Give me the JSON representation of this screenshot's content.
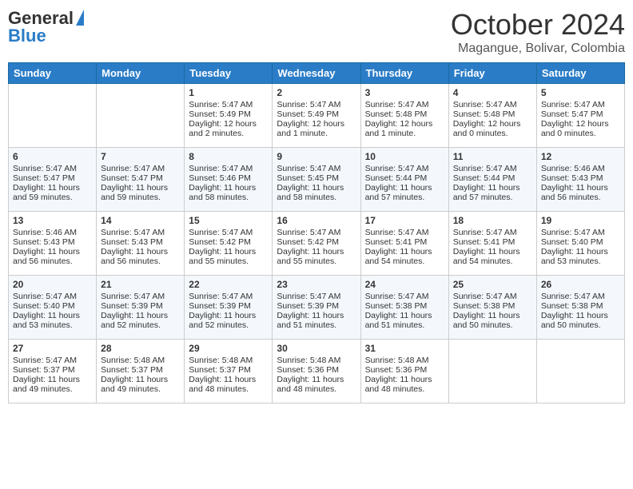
{
  "header": {
    "logo_general": "General",
    "logo_blue": "Blue",
    "month": "October 2024",
    "location": "Magangue, Bolivar, Colombia"
  },
  "days_of_week": [
    "Sunday",
    "Monday",
    "Tuesday",
    "Wednesday",
    "Thursday",
    "Friday",
    "Saturday"
  ],
  "weeks": [
    [
      {
        "day": "",
        "sunrise": "",
        "sunset": "",
        "daylight": ""
      },
      {
        "day": "",
        "sunrise": "",
        "sunset": "",
        "daylight": ""
      },
      {
        "day": "1",
        "sunrise": "Sunrise: 5:47 AM",
        "sunset": "Sunset: 5:49 PM",
        "daylight": "Daylight: 12 hours and 2 minutes."
      },
      {
        "day": "2",
        "sunrise": "Sunrise: 5:47 AM",
        "sunset": "Sunset: 5:49 PM",
        "daylight": "Daylight: 12 hours and 1 minute."
      },
      {
        "day": "3",
        "sunrise": "Sunrise: 5:47 AM",
        "sunset": "Sunset: 5:48 PM",
        "daylight": "Daylight: 12 hours and 1 minute."
      },
      {
        "day": "4",
        "sunrise": "Sunrise: 5:47 AM",
        "sunset": "Sunset: 5:48 PM",
        "daylight": "Daylight: 12 hours and 0 minutes."
      },
      {
        "day": "5",
        "sunrise": "Sunrise: 5:47 AM",
        "sunset": "Sunset: 5:47 PM",
        "daylight": "Daylight: 12 hours and 0 minutes."
      }
    ],
    [
      {
        "day": "6",
        "sunrise": "Sunrise: 5:47 AM",
        "sunset": "Sunset: 5:47 PM",
        "daylight": "Daylight: 11 hours and 59 minutes."
      },
      {
        "day": "7",
        "sunrise": "Sunrise: 5:47 AM",
        "sunset": "Sunset: 5:47 PM",
        "daylight": "Daylight: 11 hours and 59 minutes."
      },
      {
        "day": "8",
        "sunrise": "Sunrise: 5:47 AM",
        "sunset": "Sunset: 5:46 PM",
        "daylight": "Daylight: 11 hours and 58 minutes."
      },
      {
        "day": "9",
        "sunrise": "Sunrise: 5:47 AM",
        "sunset": "Sunset: 5:45 PM",
        "daylight": "Daylight: 11 hours and 58 minutes."
      },
      {
        "day": "10",
        "sunrise": "Sunrise: 5:47 AM",
        "sunset": "Sunset: 5:44 PM",
        "daylight": "Daylight: 11 hours and 57 minutes."
      },
      {
        "day": "11",
        "sunrise": "Sunrise: 5:47 AM",
        "sunset": "Sunset: 5:44 PM",
        "daylight": "Daylight: 11 hours and 57 minutes."
      },
      {
        "day": "12",
        "sunrise": "Sunrise: 5:46 AM",
        "sunset": "Sunset: 5:43 PM",
        "daylight": "Daylight: 11 hours and 56 minutes."
      }
    ],
    [
      {
        "day": "13",
        "sunrise": "Sunrise: 5:46 AM",
        "sunset": "Sunset: 5:43 PM",
        "daylight": "Daylight: 11 hours and 56 minutes."
      },
      {
        "day": "14",
        "sunrise": "Sunrise: 5:47 AM",
        "sunset": "Sunset: 5:43 PM",
        "daylight": "Daylight: 11 hours and 56 minutes."
      },
      {
        "day": "15",
        "sunrise": "Sunrise: 5:47 AM",
        "sunset": "Sunset: 5:42 PM",
        "daylight": "Daylight: 11 hours and 55 minutes."
      },
      {
        "day": "16",
        "sunrise": "Sunrise: 5:47 AM",
        "sunset": "Sunset: 5:42 PM",
        "daylight": "Daylight: 11 hours and 55 minutes."
      },
      {
        "day": "17",
        "sunrise": "Sunrise: 5:47 AM",
        "sunset": "Sunset: 5:41 PM",
        "daylight": "Daylight: 11 hours and 54 minutes."
      },
      {
        "day": "18",
        "sunrise": "Sunrise: 5:47 AM",
        "sunset": "Sunset: 5:41 PM",
        "daylight": "Daylight: 11 hours and 54 minutes."
      },
      {
        "day": "19",
        "sunrise": "Sunrise: 5:47 AM",
        "sunset": "Sunset: 5:40 PM",
        "daylight": "Daylight: 11 hours and 53 minutes."
      }
    ],
    [
      {
        "day": "20",
        "sunrise": "Sunrise: 5:47 AM",
        "sunset": "Sunset: 5:40 PM",
        "daylight": "Daylight: 11 hours and 53 minutes."
      },
      {
        "day": "21",
        "sunrise": "Sunrise: 5:47 AM",
        "sunset": "Sunset: 5:39 PM",
        "daylight": "Daylight: 11 hours and 52 minutes."
      },
      {
        "day": "22",
        "sunrise": "Sunrise: 5:47 AM",
        "sunset": "Sunset: 5:39 PM",
        "daylight": "Daylight: 11 hours and 52 minutes."
      },
      {
        "day": "23",
        "sunrise": "Sunrise: 5:47 AM",
        "sunset": "Sunset: 5:39 PM",
        "daylight": "Daylight: 11 hours and 51 minutes."
      },
      {
        "day": "24",
        "sunrise": "Sunrise: 5:47 AM",
        "sunset": "Sunset: 5:38 PM",
        "daylight": "Daylight: 11 hours and 51 minutes."
      },
      {
        "day": "25",
        "sunrise": "Sunrise: 5:47 AM",
        "sunset": "Sunset: 5:38 PM",
        "daylight": "Daylight: 11 hours and 50 minutes."
      },
      {
        "day": "26",
        "sunrise": "Sunrise: 5:47 AM",
        "sunset": "Sunset: 5:38 PM",
        "daylight": "Daylight: 11 hours and 50 minutes."
      }
    ],
    [
      {
        "day": "27",
        "sunrise": "Sunrise: 5:47 AM",
        "sunset": "Sunset: 5:37 PM",
        "daylight": "Daylight: 11 hours and 49 minutes."
      },
      {
        "day": "28",
        "sunrise": "Sunrise: 5:48 AM",
        "sunset": "Sunset: 5:37 PM",
        "daylight": "Daylight: 11 hours and 49 minutes."
      },
      {
        "day": "29",
        "sunrise": "Sunrise: 5:48 AM",
        "sunset": "Sunset: 5:37 PM",
        "daylight": "Daylight: 11 hours and 48 minutes."
      },
      {
        "day": "30",
        "sunrise": "Sunrise: 5:48 AM",
        "sunset": "Sunset: 5:36 PM",
        "daylight": "Daylight: 11 hours and 48 minutes."
      },
      {
        "day": "31",
        "sunrise": "Sunrise: 5:48 AM",
        "sunset": "Sunset: 5:36 PM",
        "daylight": "Daylight: 11 hours and 48 minutes."
      },
      {
        "day": "",
        "sunrise": "",
        "sunset": "",
        "daylight": ""
      },
      {
        "day": "",
        "sunrise": "",
        "sunset": "",
        "daylight": ""
      }
    ]
  ]
}
